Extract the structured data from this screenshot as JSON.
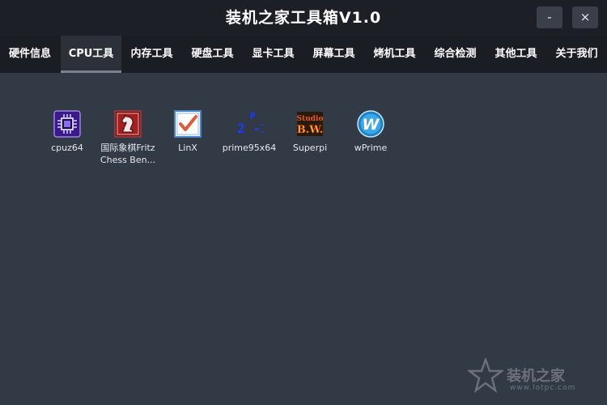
{
  "window": {
    "title": "装机之家工具箱V1.0",
    "minimize_label": "-",
    "close_label": "×"
  },
  "tabs": [
    {
      "label": "硬件信息",
      "active": false
    },
    {
      "label": "CPU工具",
      "active": true
    },
    {
      "label": "内存工具",
      "active": false
    },
    {
      "label": "硬盘工具",
      "active": false
    },
    {
      "label": "显卡工具",
      "active": false
    },
    {
      "label": "屏幕工具",
      "active": false
    },
    {
      "label": "烤机工具",
      "active": false
    },
    {
      "label": "综合检测",
      "active": false
    },
    {
      "label": "其他工具",
      "active": false
    },
    {
      "label": "关于我们",
      "active": false
    }
  ],
  "apps": [
    {
      "name": "cpuz64",
      "icon": "cpuz-chip-icon"
    },
    {
      "name_line1": "国际象棋Fritz",
      "name_line2": "Chess Ben...",
      "icon": "chess-knight-icon"
    },
    {
      "name": "LinX",
      "icon": "checkbox-icon"
    },
    {
      "name": "prime95x64",
      "icon": "prime-formula-icon",
      "icon_text_top": "P",
      "icon_text_bottom": "2 -1"
    },
    {
      "name": "Superpi",
      "icon": "superpi-icon",
      "icon_text_top": "Studio",
      "icon_text_bottom": "B.W."
    },
    {
      "name": "wPrime",
      "icon": "wprime-icon",
      "icon_text": "W"
    }
  ],
  "watermark": {
    "text": "装机之家",
    "sub": "www.lotpc.com"
  },
  "colors": {
    "titlebar": "#1c1f26",
    "navbar": "#1a1d23",
    "active_tab": "#2c3038",
    "desktop": "#323a46"
  }
}
